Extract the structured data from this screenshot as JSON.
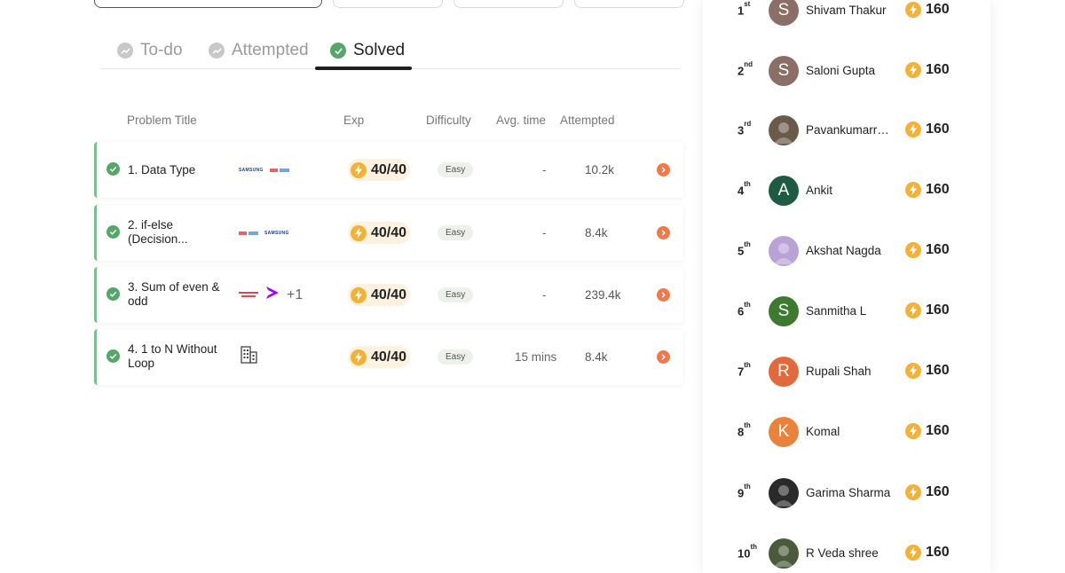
{
  "tabs": [
    {
      "label": "To-do",
      "active": false
    },
    {
      "label": "Attempted",
      "active": false
    },
    {
      "label": "Solved",
      "active": true
    }
  ],
  "table": {
    "headers": {
      "title": "Problem Title",
      "exp": "Exp",
      "difficulty": "Difficulty",
      "avg_time": "Avg. time",
      "attempted": "Attempted"
    },
    "rows": [
      {
        "title": "1. Data Type",
        "company_logos": [
          "samsung-logo",
          "small-logo"
        ],
        "extra_companies": "",
        "exp": "40/40",
        "difficulty": "Easy",
        "avg_time": "-",
        "attempted": "10.2k"
      },
      {
        "title": "2. if-else (Decision...",
        "company_logos": [
          "small-logo",
          "samsung-logo"
        ],
        "extra_companies": "",
        "exp": "40/40",
        "difficulty": "Easy",
        "avg_time": "-",
        "attempted": "8.4k"
      },
      {
        "title": "3. Sum of even & odd",
        "company_logos": [
          "small-logo",
          "accenture-logo"
        ],
        "extra_companies": "+1",
        "exp": "40/40",
        "difficulty": "Easy",
        "avg_time": "-",
        "attempted": "239.4k"
      },
      {
        "title": "4. 1 to N Without Loop",
        "company_logos": [
          "building-icon"
        ],
        "extra_companies": "",
        "exp": "40/40",
        "difficulty": "Easy",
        "avg_time": "15 mins",
        "attempted": "8.4k"
      }
    ]
  },
  "logo_text": {
    "samsung": "SAMSUNG"
  },
  "leaderboard": [
    {
      "rank": "1",
      "suffix": "st",
      "name": "Shivam Thakur",
      "score": "160",
      "avatar_letter": "S",
      "avatar_color": "#8b6f66"
    },
    {
      "rank": "2",
      "suffix": "nd",
      "name": "Saloni Gupta",
      "score": "160",
      "avatar_letter": "S",
      "avatar_color": "#8b6f66"
    },
    {
      "rank": "3",
      "suffix": "rd",
      "name": "Pavankumarreddy",
      "score": "160",
      "avatar_letter": "",
      "avatar_color": "#6a5a4a"
    },
    {
      "rank": "4",
      "suffix": "th",
      "name": "Ankit",
      "score": "160",
      "avatar_letter": "A",
      "avatar_color": "#1f5a45"
    },
    {
      "rank": "5",
      "suffix": "th",
      "name": "Akshat Nagda",
      "score": "160",
      "avatar_letter": "",
      "avatar_color": "#b9a3d6"
    },
    {
      "rank": "6",
      "suffix": "th",
      "name": "Sanmitha L",
      "score": "160",
      "avatar_letter": "S",
      "avatar_color": "#3d7a2f"
    },
    {
      "rank": "7",
      "suffix": "th",
      "name": "Rupali Shah",
      "score": "160",
      "avatar_letter": "R",
      "avatar_color": "#e06a3e"
    },
    {
      "rank": "8",
      "suffix": "th",
      "name": "Komal",
      "score": "160",
      "avatar_letter": "K",
      "avatar_color": "#e8823c"
    },
    {
      "rank": "9",
      "suffix": "th",
      "name": "Garima Sharma",
      "score": "160",
      "avatar_letter": "",
      "avatar_color": "#2a2a2a"
    },
    {
      "rank": "10",
      "suffix": "th",
      "name": "R Veda shree",
      "score": "160",
      "avatar_letter": "",
      "avatar_color": "#4a5a3a"
    }
  ],
  "colors": {
    "solved_green": "#58a56b",
    "exp_badge_bg": "#fdf1e0",
    "bolt": "#f2b23a",
    "go_arrow": "#ec7a4a"
  }
}
